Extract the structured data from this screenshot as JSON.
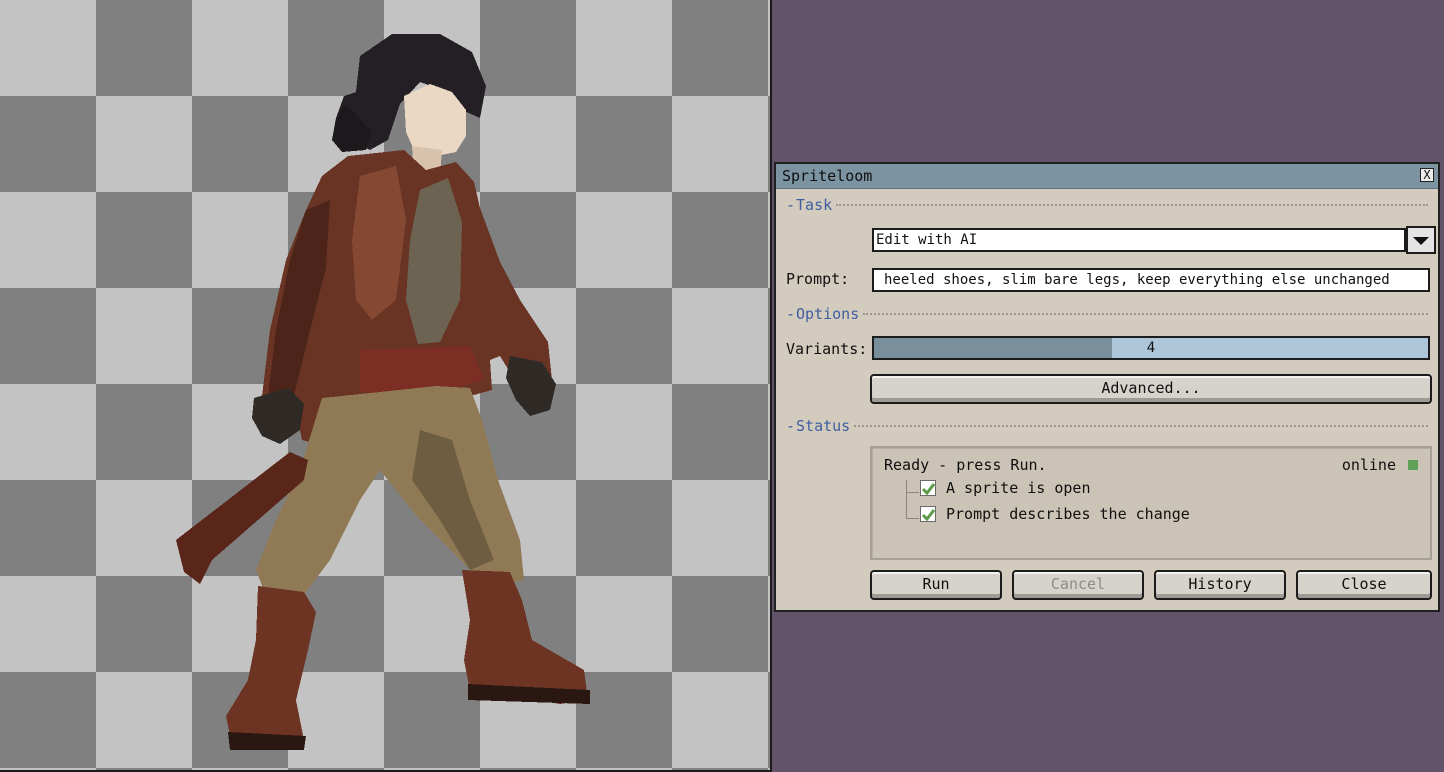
{
  "dialog": {
    "title": "Spriteloom",
    "close_glyph": "X",
    "sections": {
      "task": "Task",
      "options": "Options",
      "status": "Status"
    },
    "task": {
      "mode_value": "Edit with AI",
      "dropdown_icon": "chevron-down-icon"
    },
    "prompt": {
      "label": "Prompt:",
      "value": "heeled shoes, slim bare legs, keep everything else unchanged"
    },
    "variants": {
      "label": "Variants:",
      "value": "4",
      "fill_fraction": 0.43
    },
    "advanced_label": "Advanced...",
    "status": {
      "text": "Ready - press Run.",
      "online_label": "online",
      "online_color": "#5fa05a",
      "checks": [
        {
          "label": "A sprite is open",
          "checked": true
        },
        {
          "label": "Prompt describes the change",
          "checked": true
        }
      ]
    },
    "buttons": {
      "run": "Run",
      "cancel": "Cancel",
      "history": "History",
      "close": "Close"
    }
  },
  "colors": {
    "background": "#62526a",
    "titlebar": "#7c93a2",
    "dialog_bg": "#d3cbbd",
    "section_heading": "#3f5ea0",
    "slider_track": "#aec6da",
    "slider_fill": "#7a8f9c",
    "check": "#5a9a48"
  }
}
